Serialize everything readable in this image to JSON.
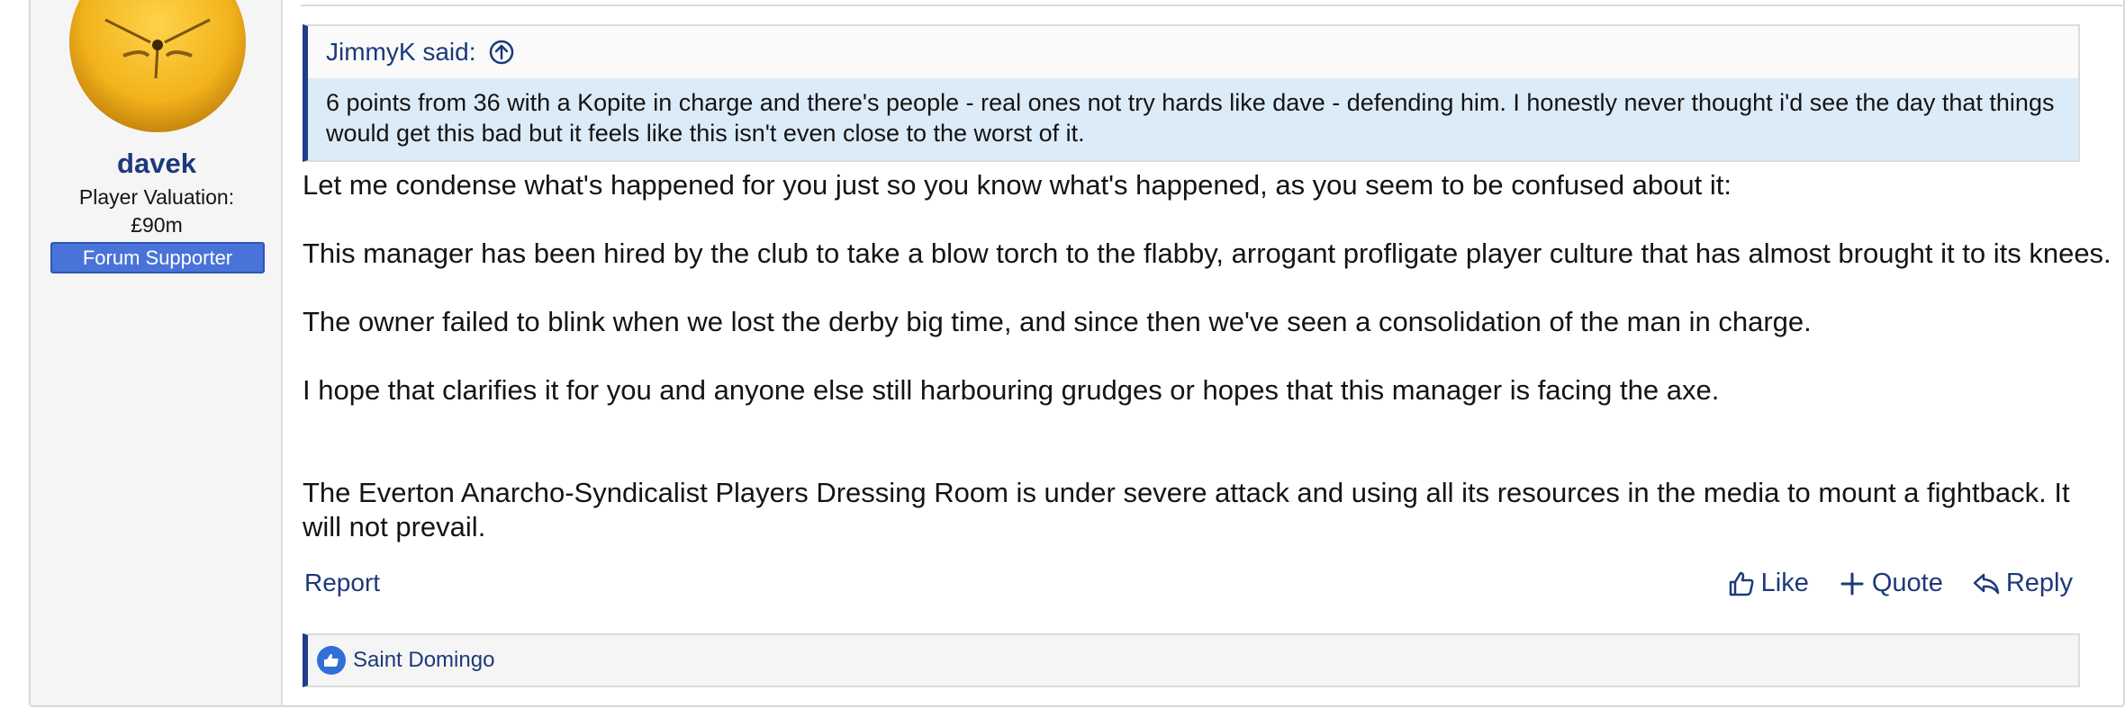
{
  "user": {
    "name": "davek",
    "valuation_label": "Player Valuation:",
    "valuation_value": "£90m",
    "banner": "Forum Supporter"
  },
  "quote": {
    "author_line": "JimmyK said:",
    "text": "6 points from 36 with a Kopite in charge and there's people - real ones not try hards like dave - defending him. I honestly never thought i'd see the day that things would get this bad but it feels like this isn't even close to the worst of it."
  },
  "post": {
    "paragraphs": [
      "Let me condense what's happened for you just so you know what's happened, as you seem to be confused about it:",
      "This manager has been hired by the club to take a blow torch to the flabby, arrogant profligate player culture that has almost brought it to its knees.",
      "The owner failed to blink when we lost the derby big time, and since then we've seen a consolidation of the man in charge.",
      "I hope that clarifies it for you and anyone else still harbouring grudges or hopes that this manager is facing the axe.",
      "The Everton Anarcho-Syndicalist Players Dressing Room is under severe attack and using all its resources in the media to mount a fightback. It will not prevail."
    ]
  },
  "footer": {
    "report": "Report",
    "like": "Like",
    "quote": "Quote",
    "reply": "Reply"
  },
  "reactions": {
    "users": "Saint Domingo"
  },
  "icons": {
    "quote_jump": "circle-up-arrow-icon",
    "like": "thumbs-up-icon",
    "quote": "plus-icon",
    "reply": "reply-arrow-icon",
    "reaction": "like-badge-icon"
  },
  "colors": {
    "link": "#1c3a7a",
    "quote_border": "#1f3d8a",
    "quote_body_bg": "#dcebf8",
    "banner_bg": "#4a73d9"
  }
}
